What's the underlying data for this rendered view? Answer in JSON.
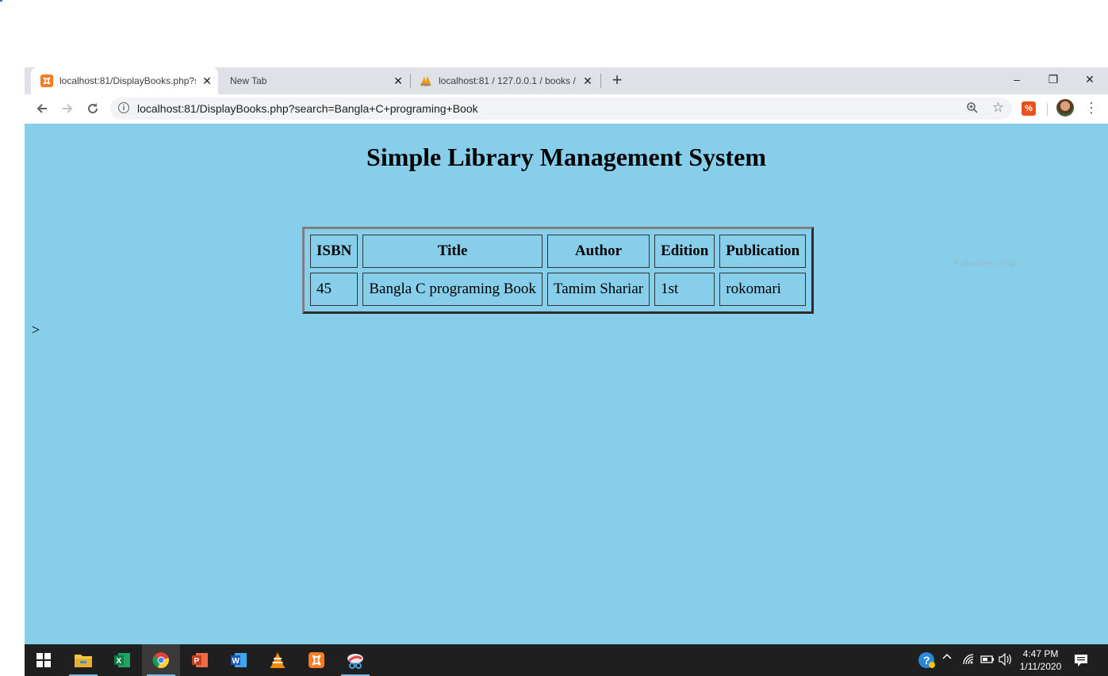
{
  "browser": {
    "tabs": [
      {
        "title": "localhost:81/DisplayBooks.php?s",
        "favicon": "xampp-icon",
        "active": true
      },
      {
        "title": "New Tab",
        "favicon": "",
        "active": false
      },
      {
        "title": "localhost:81 / 127.0.0.1 / books /",
        "favicon": "phpmyadmin-icon",
        "active": false
      }
    ],
    "new_tab_symbol": "+",
    "close_symbol": "✕",
    "window_controls": {
      "minimize": "–",
      "restore": "❐",
      "close": "✕"
    },
    "address_bar": {
      "url": "localhost:81/DisplayBooks.php?search=Bangla+C+programing+Book"
    }
  },
  "page": {
    "background_color": "#87ceeb",
    "heading": "Simple Library Management System",
    "table": {
      "headers": [
        "ISBN",
        "Title",
        "Author",
        "Edition",
        "Publication"
      ],
      "rows": [
        [
          "45",
          "Bangla C programing Book",
          "Tamim Shariar",
          "1st",
          "rokomari"
        ]
      ]
    },
    "stray_text": ">",
    "watermark": "Full-screen Snip"
  },
  "taskbar": {
    "apps": [
      "start-icon",
      "file-explorer-icon",
      "excel-icon",
      "chrome-icon",
      "powerpoint-icon",
      "word-icon",
      "vlc-icon",
      "xampp-icon",
      "snip-sketch-icon"
    ],
    "clock_time": "4:47 PM",
    "clock_date": "1/11/2020"
  }
}
